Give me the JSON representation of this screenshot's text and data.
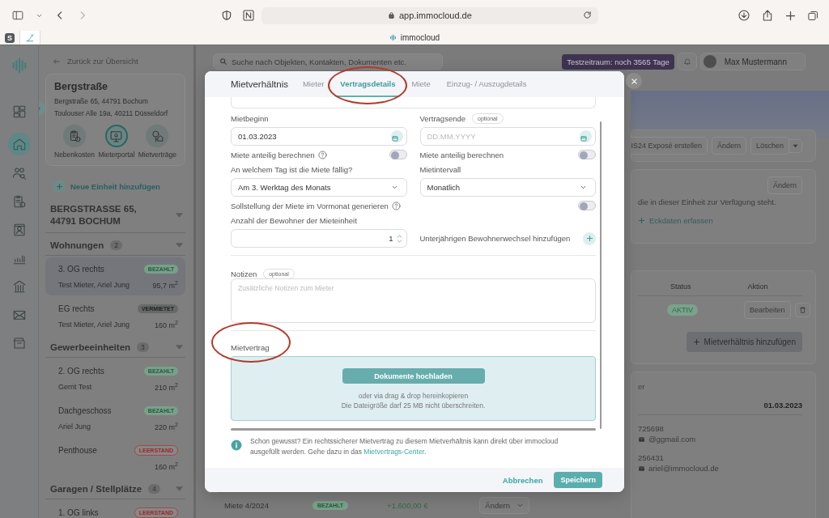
{
  "browser": {
    "pinned_tabs": [
      {
        "kind": "letter",
        "label": "S",
        "selected": false
      },
      {
        "kind": "pen",
        "selected": true
      }
    ],
    "url": "app.immocloud.de",
    "tab_title": "immocloud"
  },
  "rail": {
    "items": [
      {
        "kind": "dashboard",
        "selected": false
      },
      {
        "kind": "home",
        "selected": true
      },
      {
        "kind": "people",
        "selected": false
      },
      {
        "kind": "invoice",
        "selected": false
      },
      {
        "kind": "contact",
        "selected": false
      },
      {
        "kind": "chart",
        "selected": false
      },
      {
        "kind": "bank",
        "selected": false
      },
      {
        "kind": "mail",
        "selected": false
      },
      {
        "kind": "archive",
        "selected": false
      }
    ]
  },
  "sidebar": {
    "back_link": "Zurück zur Übersicht",
    "property": {
      "name": "Bergstraße",
      "address": "Bergstraße 65, 44791 Bochum",
      "owner_address": "Toulouser Alle 19a, 40211 Düsseldorf",
      "shortcuts": [
        {
          "kind": "costs",
          "label": "Nebenkosten",
          "selected": false
        },
        {
          "kind": "portal",
          "label": "Mieterportal",
          "selected": true
        },
        {
          "kind": "keys",
          "label": "Mietverträge",
          "selected": false
        }
      ]
    },
    "add_unit": "Neue Einheit hinzufügen",
    "building": {
      "title": "BERGSTRASSE 65, 44791 BOCHUM",
      "expanded": true
    },
    "groups": [
      {
        "title": "Wohnungen",
        "count": "2",
        "expanded": true,
        "units": [
          {
            "name": "3. OG rechts",
            "status": "BEZAHLT",
            "kind": "paid",
            "tenant": "Test Mieter, Ariel Jung",
            "area": "95,7 m$^{2}$",
            "selected": true
          },
          {
            "name": "EG rechts",
            "status": "VERMIETET",
            "kind": "rented",
            "tenant": "Test Mieter, Ariel Jung",
            "area": "160 m$^{2}$",
            "selected": false
          }
        ]
      },
      {
        "title": "Gewerbeeinheiten",
        "count": "3",
        "expanded": true,
        "units": [
          {
            "name": "2. OG rechts",
            "status": "BEZAHLT",
            "kind": "paid",
            "tenant": "Gerrit Test",
            "area": "210 m$^{2}$",
            "selected": false
          },
          {
            "name": "Dachgeschoss",
            "status": "BEZAHLT",
            "kind": "paid",
            "tenant": "Ariel Jung",
            "area": "220 m$^{2}$",
            "selected": false
          },
          {
            "name": "Penthouse",
            "status": "LEERSTAND",
            "kind": "vacant",
            "area": "160 m$^{2}$",
            "selected": false
          }
        ]
      },
      {
        "title": "Garagen / Stellplätze",
        "count": "4",
        "expanded": true,
        "units": [
          {
            "name": "1. OG links",
            "status": "LEERSTAND",
            "kind": "vacant",
            "selected": false
          }
        ]
      }
    ]
  },
  "topbar": {
    "search_placeholder": "Suche nach Objekten, Kontakten, Dokumenten etc.",
    "trial_badge": "Testzeitraum: noch 3565 Tage",
    "user_name": "Max Mustermann"
  },
  "right_panel": {
    "actions": [
      "IS24 Exposé erstellen",
      "Ändern",
      "Löschen"
    ],
    "equipment": {
      "edit": "Ändern",
      "text": "die in dieser Einheit zur Verfügung steht.",
      "add_link": "Eckdaten erfassen"
    },
    "tenancies": {
      "columns": [
        "Status",
        "Aktion"
      ],
      "rows": [
        {
          "status": "AKTIV",
          "kind": "active",
          "action": "Bearbeiten"
        }
      ],
      "add_button": "Mietverhältnis hinzufügen"
    },
    "tenant": {
      "heading": "er",
      "start_date": "01.03.2023",
      "contacts": [
        {
          "phone": "725698",
          "email": "@ggmail.com"
        },
        {
          "phone": "256431",
          "email": "ariel@immocloud.de"
        }
      ]
    }
  },
  "payments": [
    {
      "label": "Miete 4/2024",
      "status": "BEZAHLT",
      "kind": "paid",
      "amount": "+1.600,00 €",
      "action": "Ändern"
    }
  ],
  "modal": {
    "title": "Mietverhältnis",
    "tabs": [
      {
        "label": "Mieter",
        "selected": false
      },
      {
        "label": "Vertragsdetails",
        "selected": true
      },
      {
        "label": "Miete",
        "selected": false
      },
      {
        "label": "Einzug- / Auszugdetails",
        "selected": false
      }
    ],
    "start": {
      "label": "Mietbeginn",
      "value": "01.03.2023"
    },
    "end": {
      "label": "Vertragsende",
      "badge": "optional",
      "placeholder": "DD.MM.YYYY"
    },
    "prorata_toggles": [
      {
        "label": "Miete anteilig berechnen",
        "help": true,
        "on": false
      },
      {
        "label": "Miete anteilig berechnen",
        "help": false,
        "on": false
      }
    ],
    "due_day": {
      "label": "An welchem Tag ist die Miete fällig?",
      "value": "Am 3. Werktag des Monats"
    },
    "interval": {
      "label": "Mietintervall",
      "value": "Monatlich"
    },
    "advance_toggle": {
      "label": "Sollstellung der Miete im Vormonat generieren",
      "help": true,
      "on": false
    },
    "residents": {
      "label": "Anzahl der Bewohner der Mieteinheit",
      "value": "1",
      "add_label": "Unterjährigen Bewohnerwechsel hinzufügen"
    },
    "notes": {
      "label": "Notizen",
      "badge": "optional",
      "placeholder": "Zusätzliche Notizen zum Mieter"
    },
    "contract": {
      "label": "Mietvertrag",
      "upload_button": "Dokumente hochladen",
      "hint_lines": [
        "oder via drag & drop hereinkopieren",
        "Die Dateigröße darf 25 MB nicht überschreiten."
      ]
    },
    "info": {
      "text": "Schon gewusst? Ein rechtssicherer Mietvertrag zu diesem Mietverhältnis kann direkt über immocloud ausgefüllt werden. Gehe dazu in das ",
      "link": "Mietvertrags-Center",
      "after": "."
    },
    "footer": {
      "cancel": "Abbrechen",
      "save": "Speichern"
    }
  }
}
